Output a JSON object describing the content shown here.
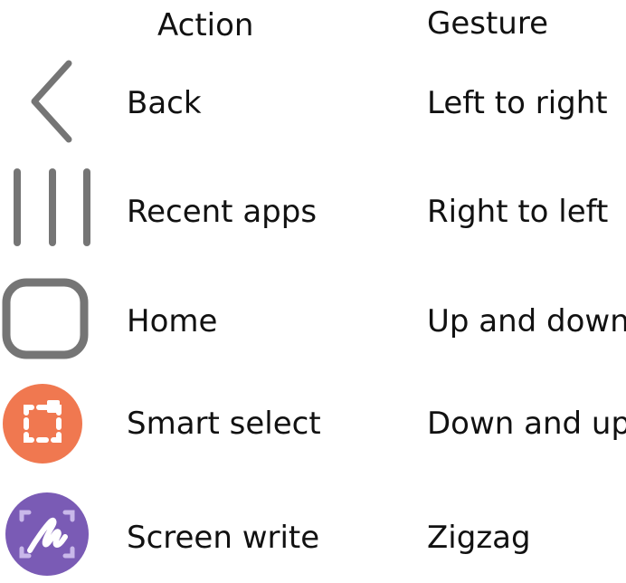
{
  "header": {
    "action_label": "Action",
    "gesture_label": "Gesture"
  },
  "colors": {
    "nav_icon_gray": "#757575",
    "smart_select_bg": "#F07850",
    "screen_write_bg": "#7A5BB5",
    "text": "#111111"
  },
  "rows": [
    {
      "icon": "back-icon",
      "action": "Back",
      "gesture": "Left to right"
    },
    {
      "icon": "recent-apps-icon",
      "action": "Recent apps",
      "gesture": "Right to left"
    },
    {
      "icon": "home-icon",
      "action": "Home",
      "gesture": "Up and down"
    },
    {
      "icon": "smart-select-icon",
      "action": "Smart select",
      "gesture": "Down and up"
    },
    {
      "icon": "screen-write-icon",
      "action": "Screen write",
      "gesture": "Zigzag"
    }
  ]
}
